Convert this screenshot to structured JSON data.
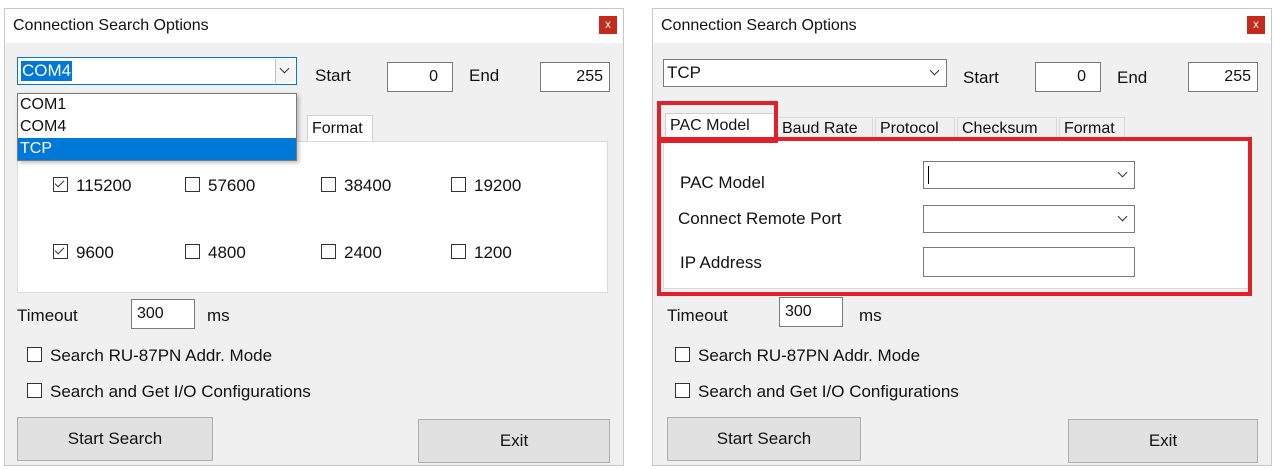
{
  "left": {
    "title": "Connection Search Options",
    "close_label": "x",
    "port": {
      "value": "COM4",
      "options": [
        "COM1",
        "COM4",
        "TCP"
      ],
      "highlighted": "TCP"
    },
    "start": {
      "label": "Start",
      "value": "0"
    },
    "end": {
      "label": "End",
      "value": "255"
    },
    "tabs": [
      "Format"
    ],
    "baud_rates": [
      {
        "value": "115200",
        "checked": true
      },
      {
        "value": "57600",
        "checked": false
      },
      {
        "value": "38400",
        "checked": false
      },
      {
        "value": "19200",
        "checked": false
      },
      {
        "value": "9600",
        "checked": true
      },
      {
        "value": "4800",
        "checked": false
      },
      {
        "value": "2400",
        "checked": false
      },
      {
        "value": "1200",
        "checked": false
      }
    ],
    "timeout": {
      "label": "Timeout",
      "value": "300",
      "unit": "ms"
    },
    "options": [
      {
        "label": "Search RU-87PN Addr. Mode",
        "checked": false
      },
      {
        "label": "Search and Get I/O Configurations",
        "checked": false
      }
    ],
    "start_search": "Start Search",
    "exit": "Exit"
  },
  "right": {
    "title": "Connection Search Options",
    "close_label": "x",
    "port": {
      "value": "TCP"
    },
    "start": {
      "label": "Start",
      "value": "0"
    },
    "end": {
      "label": "End",
      "value": "255"
    },
    "tabs": [
      "PAC Model",
      "Baud Rate",
      "Protocol",
      "Checksum",
      "Format"
    ],
    "fields": {
      "pac_model_label": "PAC Model",
      "remote_port_label": "Connect Remote Port",
      "ip_label": "IP Address"
    },
    "timeout": {
      "label": "Timeout",
      "value": "300",
      "unit": "ms"
    },
    "options": [
      {
        "label": "Search RU-87PN Addr. Mode",
        "checked": false
      },
      {
        "label": "Search and Get I/O Configurations",
        "checked": false
      }
    ],
    "start_search": "Start Search",
    "exit": "Exit"
  },
  "colors": {
    "highlight_red": "#e0202a",
    "selection_blue": "#0078d7",
    "close_red": "#c42b1c"
  }
}
